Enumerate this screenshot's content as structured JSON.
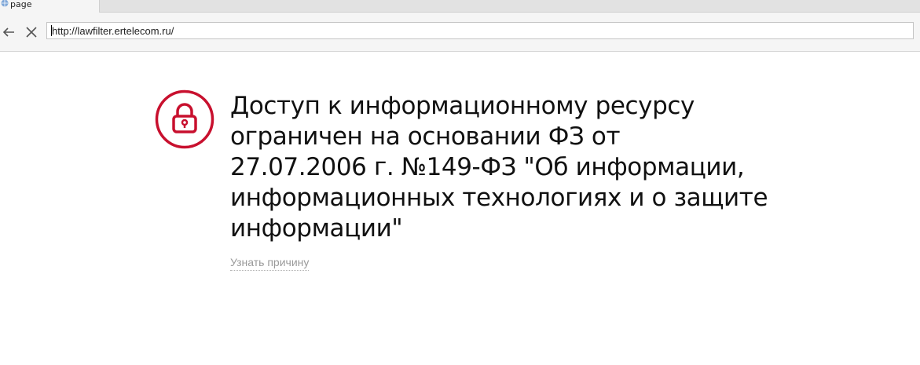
{
  "browser": {
    "tab": {
      "title": "page",
      "favicon": "globe-icon"
    },
    "nav": {
      "back_icon": "arrow-left-icon",
      "stop_icon": "close-icon"
    },
    "address_bar": {
      "value": "http://lawfilter.ertelecom.ru/"
    }
  },
  "block_page": {
    "icon": "lock-icon",
    "accent_color": "#c8102e",
    "headline_lines": [
      "Доступ к информационному ресурсу",
      "ограничен на основании ФЗ от",
      "27.07.2006 г. №149-ФЗ \"Об информации,",
      "информационных технологиях и о защите",
      "информации\""
    ],
    "reason_link": "Узнать причину"
  }
}
